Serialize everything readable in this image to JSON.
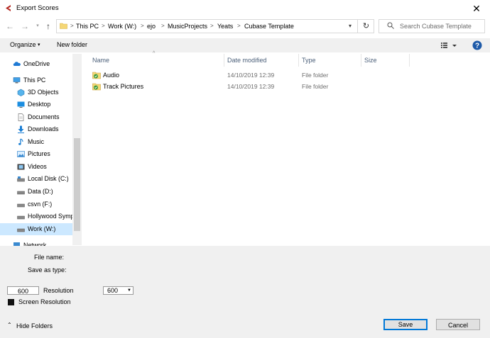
{
  "window": {
    "title": "Export Scores"
  },
  "address": {
    "crumbs": [
      "This PC",
      "Work (W:)",
      "ejo",
      "MusicProjects",
      "Yeats",
      "Cubase Template"
    ],
    "separator": ">"
  },
  "search": {
    "placeholder": "Search Cubase Template"
  },
  "toolbar": {
    "organize": "Organize",
    "new_folder": "New folder"
  },
  "nav": {
    "items": [
      {
        "label": "OneDrive",
        "icon": "cloud-icon"
      },
      {
        "label": "This PC",
        "icon": "computer-icon"
      },
      {
        "label": "3D Objects",
        "icon": "cube-icon"
      },
      {
        "label": "Desktop",
        "icon": "desktop-icon"
      },
      {
        "label": "Documents",
        "icon": "documents-icon"
      },
      {
        "label": "Downloads",
        "icon": "download-icon"
      },
      {
        "label": "Music",
        "icon": "music-note-icon"
      },
      {
        "label": "Pictures",
        "icon": "pictures-icon"
      },
      {
        "label": "Videos",
        "icon": "videos-icon"
      },
      {
        "label": "Local Disk (C:)",
        "icon": "drive-icon"
      },
      {
        "label": "Data (D:)",
        "icon": "drive-icon"
      },
      {
        "label": "csvn (F:)",
        "icon": "drive-icon"
      },
      {
        "label": "Hollywood Symp",
        "icon": "drive-icon"
      },
      {
        "label": "Work (W:)",
        "icon": "drive-icon",
        "selected": true
      },
      {
        "label": "Network",
        "icon": "network-icon"
      }
    ]
  },
  "columns": {
    "name": "Name",
    "date": "Date modified",
    "type": "Type",
    "size": "Size"
  },
  "files": [
    {
      "name": "Audio",
      "date": "14/10/2019 12:39",
      "type": "File folder"
    },
    {
      "name": "Track Pictures",
      "date": "14/10/2019 12:39",
      "type": "File folder"
    }
  ],
  "form": {
    "file_name_label": "File name:",
    "save_as_type_label": "Save as type:",
    "resolution_value": "600",
    "resolution_label": "Resolution",
    "resolution_select": "600",
    "screen_resolution_label": "Screen Resolution",
    "screen_resolution_checked": true
  },
  "footer": {
    "hide_folders": "Hide Folders",
    "save": "Save",
    "cancel": "Cancel"
  },
  "colors": {
    "accent": "#0078d7",
    "selection": "#cce8ff",
    "folder": "#e8c04a"
  }
}
